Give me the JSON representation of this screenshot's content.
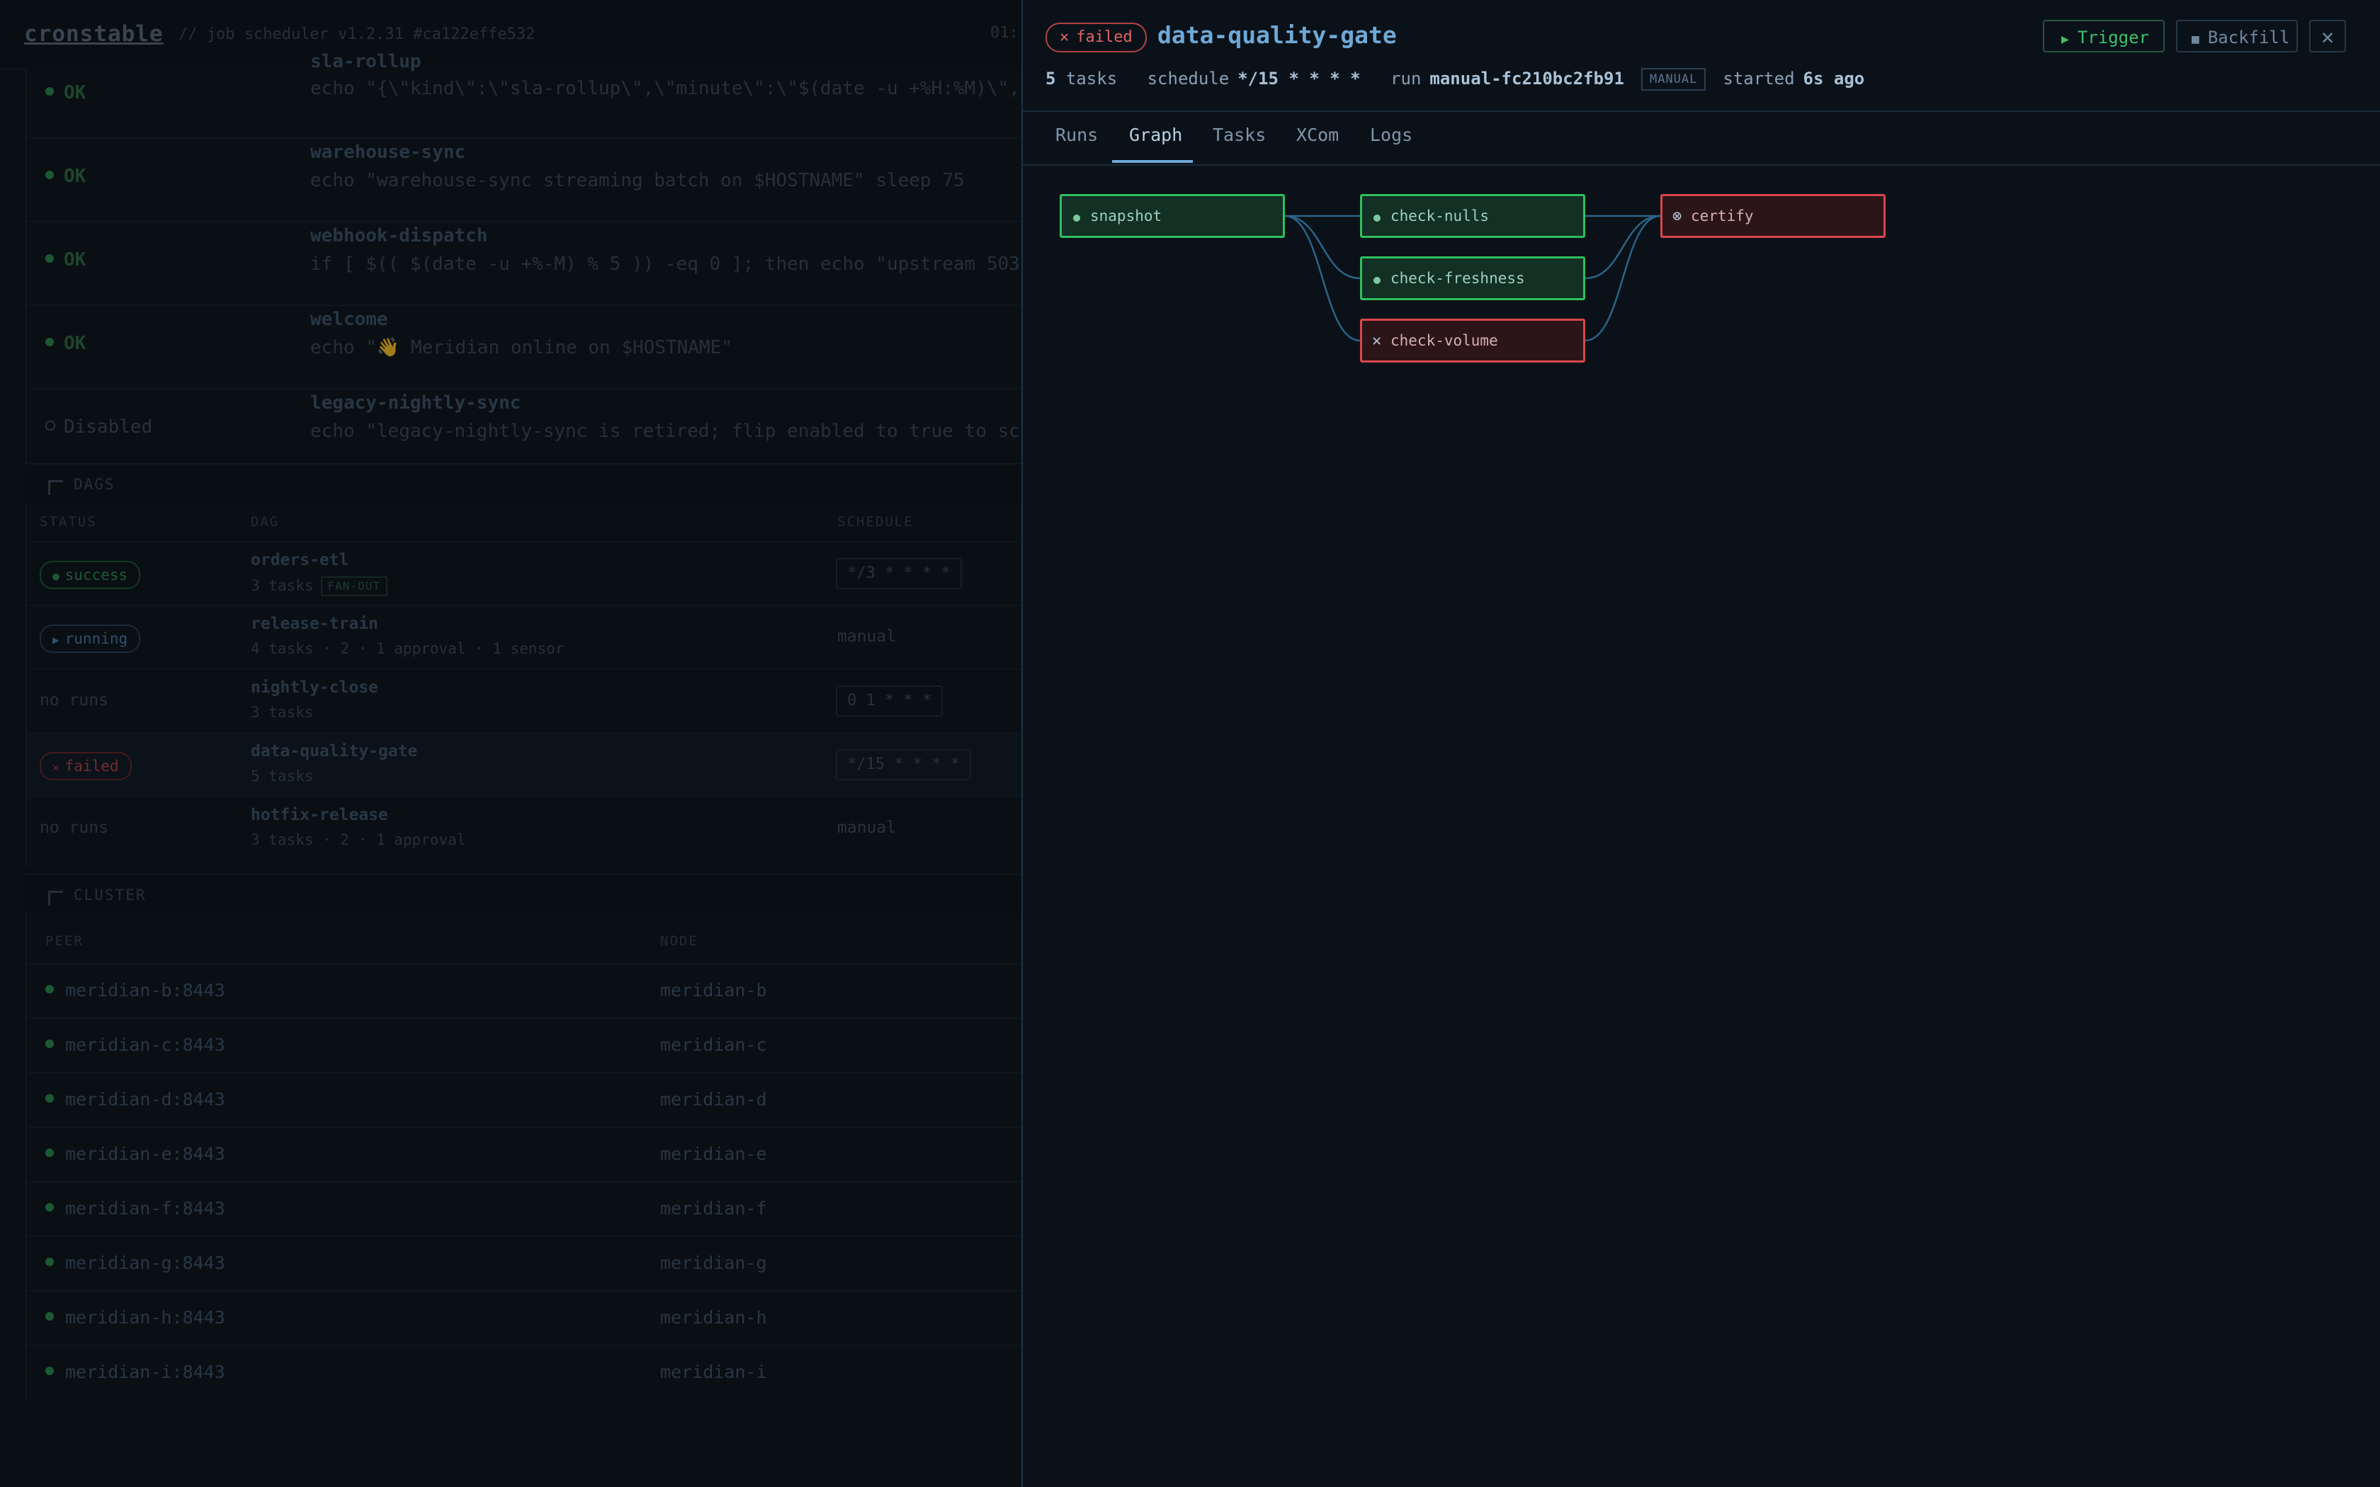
{
  "app": {
    "brand": "cronstable",
    "brand_sup": "\"",
    "subtitle": "// job scheduler  v1.2.31  #ca122effe532",
    "clock": "01:"
  },
  "jobs": [
    {
      "status": "OK",
      "name": "sla-rollup",
      "command": "echo \"{\\\"kind\\\":\\\"sla-rollup\\\",\\\"minute\\\":\\\"$(date -u +%H:%M)\\\","
    },
    {
      "status": "OK",
      "name": "warehouse-sync",
      "command": "echo \"warehouse-sync streaming batch on $HOSTNAME\" sleep 75"
    },
    {
      "status": "OK",
      "name": "webhook-dispatch",
      "command": "if [ $(( $(date -u +%-M) % 5 )) -eq 0 ]; then echo \"upstream 503"
    },
    {
      "status": "OK",
      "name": "welcome",
      "command": "echo \"👋 Meridian online on $HOSTNAME\""
    },
    {
      "status": "Disabled",
      "name": "legacy-nightly-sync",
      "command": "echo \"legacy-nightly-sync is retired; flip enabled to true to sc"
    }
  ],
  "dags_section": {
    "title": "DAGS",
    "columns": [
      "STATUS",
      "DAG",
      "SCHEDULE"
    ],
    "rows": [
      {
        "status": "success",
        "name": "orders-etl",
        "meta": "3 tasks",
        "tag": "FAN-OUT",
        "schedule": "*/3 * * * *",
        "boxed": true
      },
      {
        "status": "running",
        "name": "release-train",
        "meta": "4 tasks · 2 · 1 approval · 1 sensor",
        "tag": "",
        "schedule": "manual",
        "boxed": false
      },
      {
        "status": "no runs",
        "name": "nightly-close",
        "meta": "3 tasks",
        "tag": "",
        "schedule": "0 1 * * *",
        "boxed": true
      },
      {
        "status": "failed",
        "name": "data-quality-gate",
        "meta": "5 tasks",
        "tag": "",
        "schedule": "*/15 * * * *",
        "boxed": true
      },
      {
        "status": "no runs",
        "name": "hotfix-release",
        "meta": "3 tasks · 2 · 1 approval",
        "tag": "",
        "schedule": "manual",
        "boxed": false
      }
    ]
  },
  "cluster_section": {
    "title": "CLUSTER",
    "columns": [
      "PEER",
      "NODE"
    ],
    "rows": [
      {
        "peer": "meridian-b:8443",
        "node": "meridian-b"
      },
      {
        "peer": "meridian-c:8443",
        "node": "meridian-c"
      },
      {
        "peer": "meridian-d:8443",
        "node": "meridian-d"
      },
      {
        "peer": "meridian-e:8443",
        "node": "meridian-e"
      },
      {
        "peer": "meridian-f:8443",
        "node": "meridian-f"
      },
      {
        "peer": "meridian-g:8443",
        "node": "meridian-g"
      },
      {
        "peer": "meridian-h:8443",
        "node": "meridian-h"
      },
      {
        "peer": "meridian-i:8443",
        "node": "meridian-i"
      }
    ]
  },
  "drawer": {
    "status": "failed",
    "title": "data-quality-gate",
    "tasks_count": "5",
    "tasks_label": "tasks",
    "schedule_label": "schedule",
    "schedule": "*/15 * * * *",
    "run_label": "run",
    "run_id": "manual-fc210bc2fb91",
    "run_badge": "MANUAL",
    "started_label": "started",
    "started": "6s ago",
    "trigger_label": "Trigger",
    "backfill_label": "Backfill",
    "close_label": "✕",
    "tabs": [
      "Runs",
      "Graph",
      "Tasks",
      "XCom",
      "Logs"
    ],
    "active_tab": "Graph"
  },
  "graph": {
    "nodes": [
      {
        "id": "snapshot",
        "label": "snapshot",
        "state": "success",
        "column": 0,
        "row": 0
      },
      {
        "id": "check-nulls",
        "label": "check-nulls",
        "state": "success",
        "column": 1,
        "row": 0
      },
      {
        "id": "check-freshness",
        "label": "check-freshness",
        "state": "success",
        "column": 1,
        "row": 1
      },
      {
        "id": "check-volume",
        "label": "check-volume",
        "state": "failed",
        "column": 1,
        "row": 2
      },
      {
        "id": "certify",
        "label": "certify",
        "state": "upstream_failed",
        "column": 2,
        "row": 0
      }
    ],
    "edges": [
      [
        "snapshot",
        "check-nulls"
      ],
      [
        "snapshot",
        "check-freshness"
      ],
      [
        "snapshot",
        "check-volume"
      ],
      [
        "check-nulls",
        "certify"
      ],
      [
        "check-freshness",
        "certify"
      ],
      [
        "check-volume",
        "certify"
      ]
    ],
    "colors": {
      "success": "#2fbf5c",
      "failed": "#d9474b",
      "edge": "#2a6488",
      "accent": "#6ea8d6"
    }
  }
}
